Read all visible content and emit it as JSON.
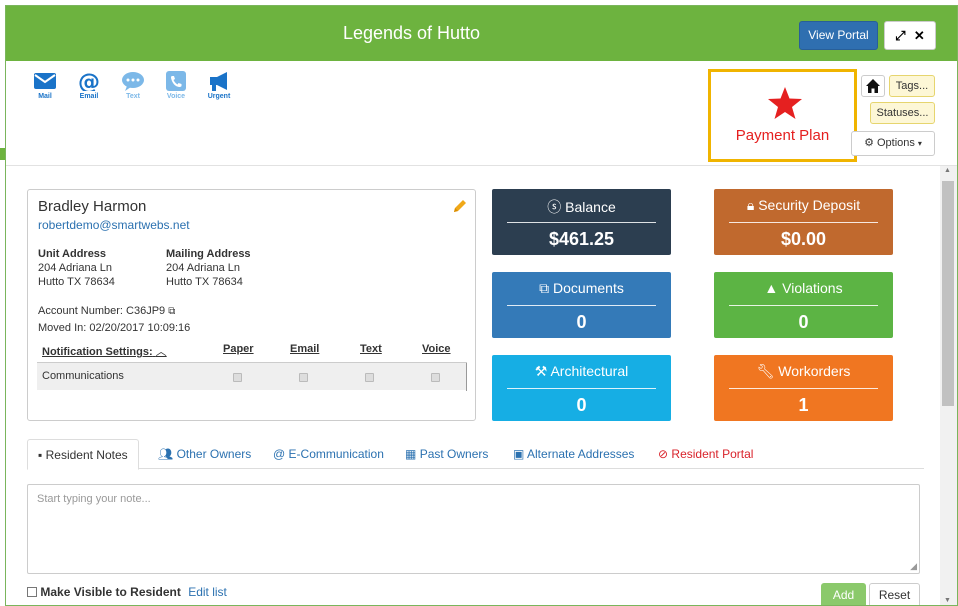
{
  "window": {
    "title": "Legends of Hutto",
    "view_portal": "View Portal",
    "expand_icon": "expand-icon",
    "close_icon": "close-icon"
  },
  "comm_buttons": [
    {
      "label": "Mail",
      "icon": "envelope-icon",
      "color": "#1a73c8"
    },
    {
      "label": "Email",
      "icon": "at-icon",
      "color": "#1a73c8"
    },
    {
      "label": "Text",
      "icon": "chat-icon",
      "color": "#7cb8e8"
    },
    {
      "label": "Voice",
      "icon": "phone-icon",
      "color": "#7cb8e8"
    },
    {
      "label": "Urgent",
      "icon": "megaphone-icon",
      "color": "#1a73c8"
    }
  ],
  "payment_plan": {
    "label": "Payment Plan",
    "icon": "star-icon",
    "color": "#e52020"
  },
  "side_buttons": {
    "tags": "Tags...",
    "statuses": "Statuses...",
    "options": "Options"
  },
  "resident": {
    "name": "Bradley Harmon",
    "email": "robertdemo@smartwebs.net",
    "unit_address_label": "Unit Address",
    "unit_address_line1": "204 Adriana Ln",
    "unit_address_line2": "Hutto TX 78634",
    "mailing_address_label": "Mailing Address",
    "mailing_address_line1": "204 Adriana Ln",
    "mailing_address_line2": "Hutto TX 78634",
    "account_number": "Account Number: C36JP9",
    "moved_in": "Moved In: 02/20/2017 10:09:16"
  },
  "notifications": {
    "header": "Notification Settings:",
    "columns": [
      "Paper",
      "Email",
      "Text",
      "Voice"
    ],
    "rows": [
      {
        "label": "Communications",
        "values": [
          true,
          true,
          true,
          true
        ]
      }
    ]
  },
  "tiles": [
    {
      "title": "Balance",
      "value": "$461.25",
      "icon": "dollar-circle-icon",
      "color": "#2c3e50"
    },
    {
      "title": "Security Deposit",
      "value": "$0.00",
      "icon": "lock-icon",
      "color": "#c0692e"
    },
    {
      "title": "Documents",
      "value": "0",
      "icon": "copy-icon",
      "color": "#347ab8"
    },
    {
      "title": "Violations",
      "value": "0",
      "icon": "warning-icon",
      "color": "#5cb444"
    },
    {
      "title": "Architectural",
      "value": "0",
      "icon": "hammer-icon",
      "color": "#16aee4"
    },
    {
      "title": "Workorders",
      "value": "1",
      "icon": "wrench-icon",
      "color": "#f07621"
    }
  ],
  "tabs": [
    {
      "label": "Resident Notes",
      "icon": "note-icon"
    },
    {
      "label": "Other Owners",
      "icon": "users-icon"
    },
    {
      "label": "E-Communication",
      "icon": "at-icon"
    },
    {
      "label": "Past Owners",
      "icon": "table-icon"
    },
    {
      "label": "Alternate Addresses",
      "icon": "address-card-icon"
    },
    {
      "label": "Resident Portal",
      "icon": "ban-icon",
      "color": "#d9232b"
    }
  ],
  "notes": {
    "placeholder": "Start typing your note...",
    "visible_label": "Make Visible to Resident",
    "edit_list": "Edit list",
    "add": "Add",
    "reset": "Reset"
  }
}
